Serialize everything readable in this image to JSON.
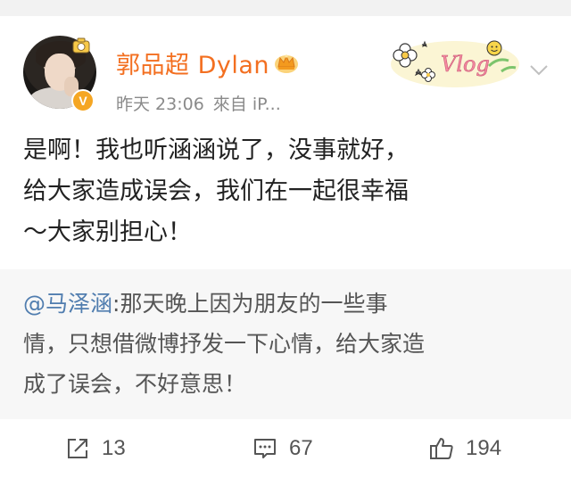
{
  "header": {
    "username": "郭品超 Dylan",
    "timestamp": "昨天 23:06",
    "source": "來自 iP..."
  },
  "post": {
    "lines": [
      "是啊！我也听涵涵说了，没事就好，",
      "给大家造成误会，我们在一起很幸福",
      "～大家别担心！"
    ]
  },
  "repost": {
    "mention": "@马泽涵",
    "line1_rest": ":那天晚上因为朋友的一些事",
    "line2": "情，只想借微博抒发一下心情，给大家造",
    "line3": "成了误会，不好意思！"
  },
  "actions": {
    "repost_count": "13",
    "comment_count": "67",
    "like_count": "194"
  },
  "icons": {
    "verified": "verified-v-badge-icon",
    "vip": "crown-icon",
    "expand": "chevron-down-icon",
    "repost": "share-arrow-icon",
    "comment": "comment-bubble-icon",
    "like": "thumbs-up-icon"
  },
  "decoration": {
    "vlog_text": "Vlog"
  },
  "colors": {
    "username": "#f36f20",
    "mention": "#507daf",
    "verified_badge": "#f5a623",
    "repost_background": "#f7f7f7"
  }
}
